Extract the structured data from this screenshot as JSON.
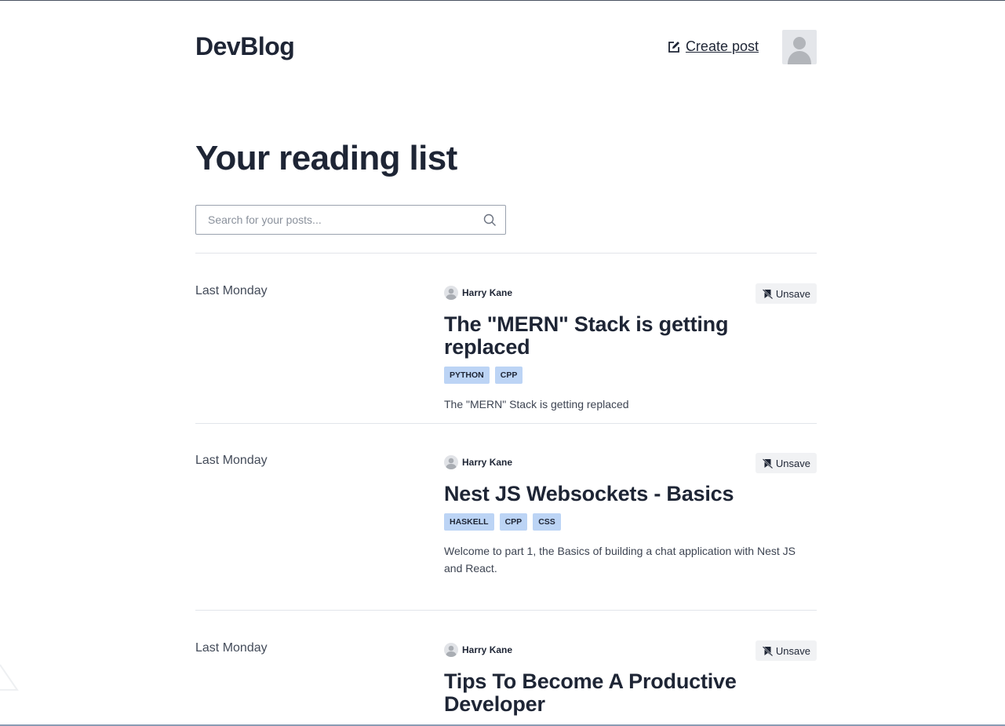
{
  "header": {
    "logo": "DevBlog",
    "create_post_label": "Create post"
  },
  "page_title": "Your reading list",
  "search": {
    "placeholder": "Search for your posts...",
    "value": ""
  },
  "posts": [
    {
      "date": "Last Monday",
      "author": "Harry Kane",
      "unsave_label": "Unsave",
      "title": "The \"MERN\" Stack is getting replaced",
      "tags": [
        "PYTHON",
        "CPP"
      ],
      "excerpt": "The \"MERN\" Stack is getting replaced"
    },
    {
      "date": "Last Monday",
      "author": "Harry Kane",
      "unsave_label": "Unsave",
      "title": "Nest JS Websockets - Basics",
      "tags": [
        "HASKELL",
        "CPP",
        "CSS"
      ],
      "excerpt": "Welcome to part 1, the Basics of building a chat application with Nest JS and React."
    },
    {
      "date": "Last Monday",
      "author": "Harry Kane",
      "unsave_label": "Unsave",
      "title": "Tips To Become A Productive Developer",
      "tags": [],
      "excerpt": ""
    }
  ]
}
